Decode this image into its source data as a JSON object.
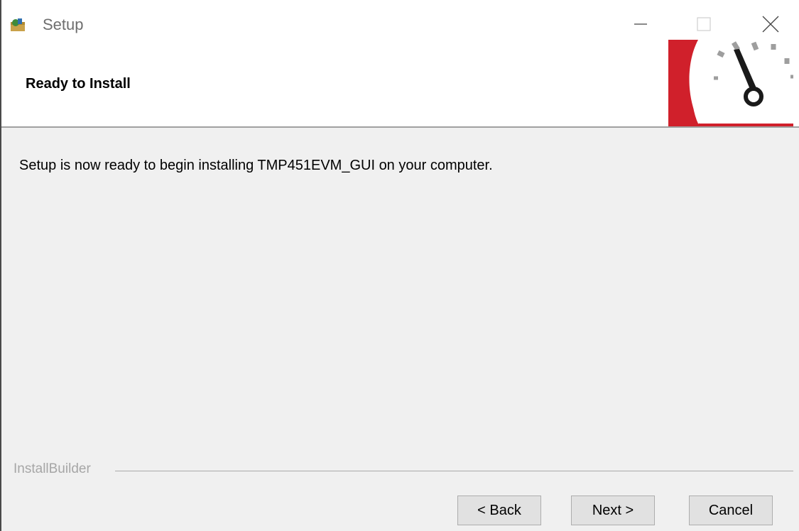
{
  "window": {
    "title": "Setup",
    "icon": "setup-app-icon",
    "controls": [
      "minimize-icon",
      "maximize-icon",
      "close-icon"
    ]
  },
  "header": {
    "title": "Ready to Install",
    "logo": "speedometer-logo-icon"
  },
  "body": {
    "message": "Setup is now ready to begin installing TMP451EVM_GUI on your computer."
  },
  "footer": {
    "brand": "InstallBuilder",
    "buttons": {
      "back": "< Back",
      "next": "Next >",
      "cancel": "Cancel"
    }
  },
  "colors": {
    "body_bg": "#f0f0f0",
    "header_bg": "#ffffff",
    "logo_red": "#d0202b",
    "gauge_gray": "#9e9e9e"
  }
}
